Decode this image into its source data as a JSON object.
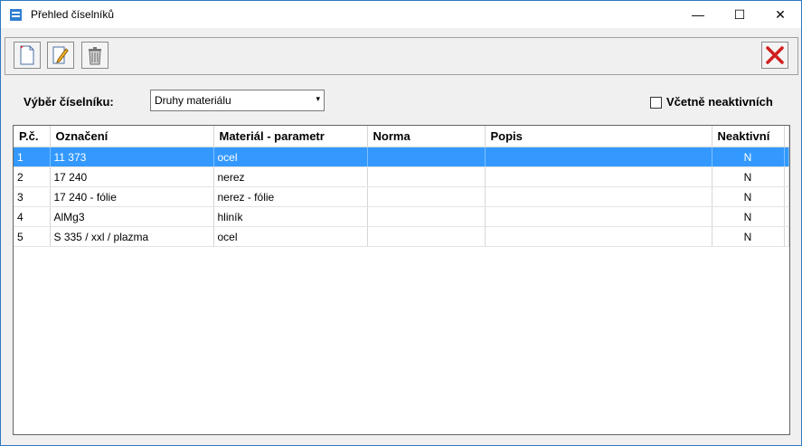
{
  "window": {
    "title": "Přehled číselníků",
    "controls": {
      "minimize": "—",
      "maximize": "☐",
      "close": "✕"
    }
  },
  "filter": {
    "label": "Výběr číselníku:",
    "selected": "Druhy materiálu",
    "include_inactive_label": "Včetně neaktivních",
    "include_inactive_checked": false
  },
  "table": {
    "headers": [
      "P.č.",
      "Označení",
      "Materiál - parametr",
      "Norma",
      "Popis",
      "Neaktivní"
    ],
    "rows": [
      [
        "1",
        "11 373",
        "ocel",
        "",
        "",
        "N"
      ],
      [
        "2",
        "17 240",
        "nerez",
        "",
        "",
        "N"
      ],
      [
        "3",
        "17 240 - fólie",
        "nerez - fólie",
        "",
        "",
        "N"
      ],
      [
        "4",
        "AlMg3",
        "hliník",
        "",
        "",
        "N"
      ],
      [
        "5",
        "S 335 / xxl / plazma",
        "ocel",
        "",
        "",
        "N"
      ]
    ],
    "selected_row": 0
  },
  "colors": {
    "selection": "#3399ff",
    "exit_icon": "#d11f1f"
  }
}
